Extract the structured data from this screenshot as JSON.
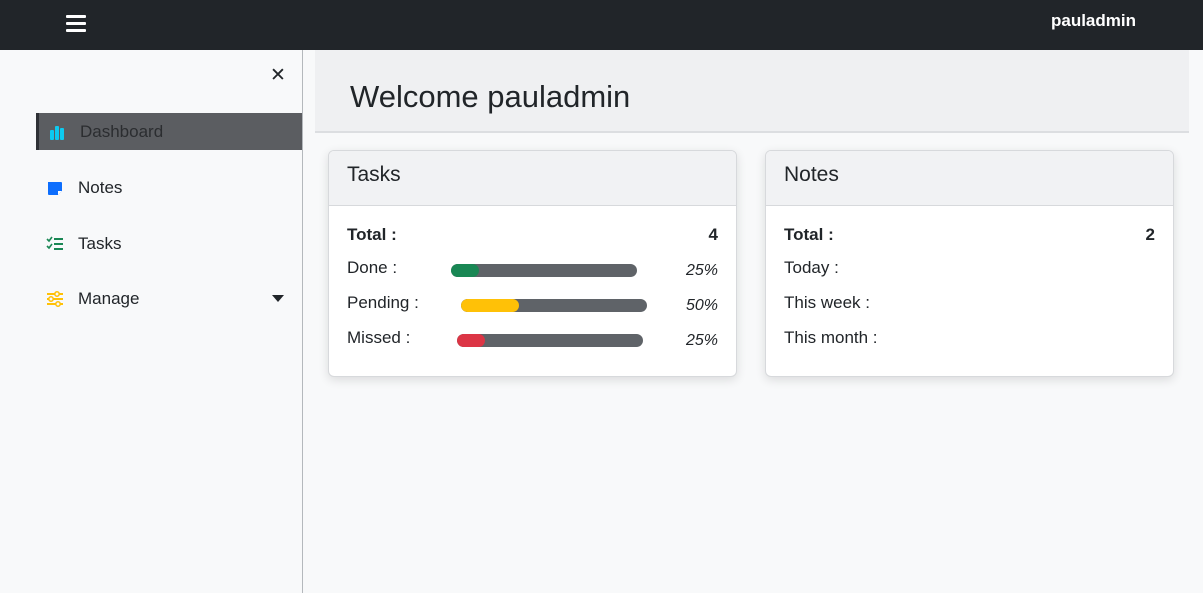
{
  "topbar": {
    "username": "pauladmin",
    "menu_icon": "hamburger-icon"
  },
  "sidebar": {
    "close_icon": "close-icon",
    "close_glyph": "✕",
    "items": [
      {
        "label": "Dashboard",
        "icon": "bar-chart-icon",
        "icon_color": "#0dcaf0",
        "active": true
      },
      {
        "label": "Notes",
        "icon": "sticky-note-icon",
        "icon_color": "#0d6efd"
      },
      {
        "label": "Tasks",
        "icon": "checklist-icon",
        "icon_color": "#198754"
      },
      {
        "label": "Manage",
        "icon": "sliders-icon",
        "icon_color": "#ffc107",
        "has_dropdown": true
      }
    ]
  },
  "main": {
    "welcome": "Welcome pauladmin",
    "tasks_card": {
      "title": "Tasks",
      "total_label": "Total :",
      "total_value": "4",
      "rows": [
        {
          "label": "Done :",
          "percent_text": "25%",
          "fill": 0.15,
          "color": "#198754"
        },
        {
          "label": "Pending :",
          "percent_text": "50%",
          "fill": 0.31,
          "color": "#ffc107"
        },
        {
          "label": "Missed :",
          "percent_text": "25%",
          "fill": 0.15,
          "color": "#dc3545"
        }
      ]
    },
    "notes_card": {
      "title": "Notes",
      "total_label": "Total :",
      "total_value": "2",
      "rows": [
        {
          "label": "Today :"
        },
        {
          "label": "This week :"
        },
        {
          "label": "This month :"
        }
      ]
    }
  }
}
